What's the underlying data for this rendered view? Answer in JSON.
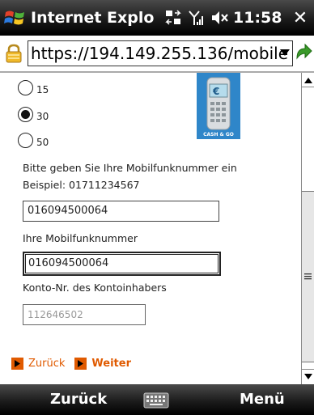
{
  "titlebar": {
    "app_title": "Internet Explo",
    "clock": "11:58",
    "close": "✕"
  },
  "addressbar": {
    "url": "https://194.149.255.136/mobile"
  },
  "form": {
    "options": [
      {
        "label": "15",
        "selected": false
      },
      {
        "label": "30",
        "selected": true
      },
      {
        "label": "50",
        "selected": false
      }
    ],
    "logo_caption": "CASH & GO",
    "instruction": "Bitte geben Sie Ihre Mobilfunknummer ein",
    "example": "Beispiel: 01711234567",
    "mobile_value_1": "016094500064",
    "mobile_label": "Ihre Mobilfunknummer",
    "mobile_value_2": "016094500064",
    "account_label": "Konto-Nr. des Kontoinhabers",
    "account_value": "112646502",
    "back_link": "Zurück",
    "next_link": "Weiter"
  },
  "softkeys": {
    "left": "Zurück",
    "right": "Menü"
  },
  "colors": {
    "accent": "#e05a00",
    "bar": "#1b1b1b"
  }
}
